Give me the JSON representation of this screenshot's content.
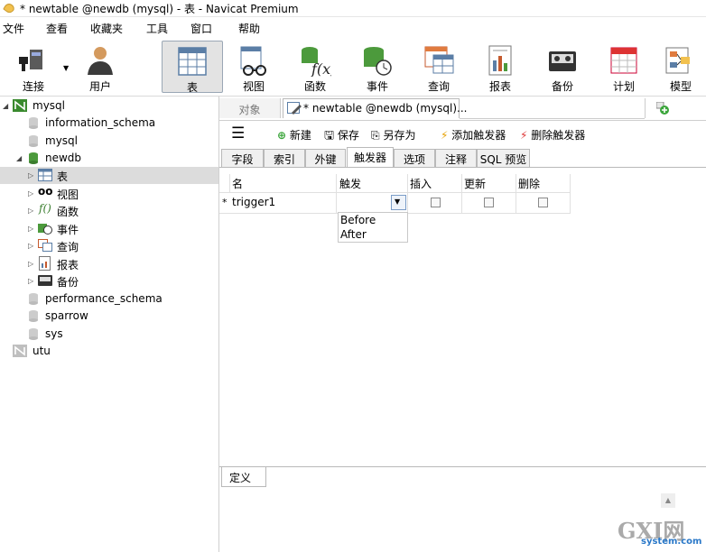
{
  "window": {
    "title": "* newtable @newdb (mysql) - 表 - Navicat Premium"
  },
  "menu": [
    "文件",
    "查看",
    "收藏夹",
    "工具",
    "窗口",
    "帮助"
  ],
  "toolbar": {
    "buttons": [
      {
        "label": "连接",
        "icon": "plug-icon"
      },
      {
        "label": "用户",
        "icon": "user-icon"
      },
      {
        "label": "表",
        "icon": "table-icon"
      },
      {
        "label": "视图",
        "icon": "view-icon"
      },
      {
        "label": "函数",
        "icon": "function-icon"
      },
      {
        "label": "事件",
        "icon": "event-icon"
      },
      {
        "label": "查询",
        "icon": "query-icon"
      },
      {
        "label": "报表",
        "icon": "report-icon"
      },
      {
        "label": "备份",
        "icon": "backup-icon"
      },
      {
        "label": "计划",
        "icon": "schedule-icon"
      },
      {
        "label": "模型",
        "icon": "model-icon"
      }
    ]
  },
  "tree": {
    "conn1": "mysql",
    "db_information_schema": "information_schema",
    "db_mysql": "mysql",
    "db_newdb": "newdb",
    "obj_table": "表",
    "obj_view": "视图",
    "obj_function": "函数",
    "obj_event": "事件",
    "obj_query": "查询",
    "obj_report": "报表",
    "obj_backup": "备份",
    "db_performance_schema": "performance_schema",
    "db_sparrow": "sparrow",
    "db_sys": "sys",
    "conn2": "utu"
  },
  "tabs": {
    "objects": "对象",
    "editor": "* newtable @newdb (mysql)..."
  },
  "actions": {
    "new": "新建",
    "save": "保存",
    "save_as": "另存为",
    "add_trigger": "添加触发器",
    "delete_trigger": "删除触发器"
  },
  "inner_tabs": [
    "字段",
    "索引",
    "外键",
    "触发器",
    "选项",
    "注释",
    "SQL 预览"
  ],
  "grid": {
    "headers": {
      "name": "名",
      "fire": "触发",
      "insert": "插入",
      "update": "更新",
      "delete": "删除"
    },
    "row_marker": "*",
    "row_name": "trigger1",
    "dropdown_options": [
      "Before",
      "After"
    ]
  },
  "definition": {
    "tab": "定义"
  },
  "watermark": {
    "text": "GXI网",
    "sub": "system.com"
  }
}
